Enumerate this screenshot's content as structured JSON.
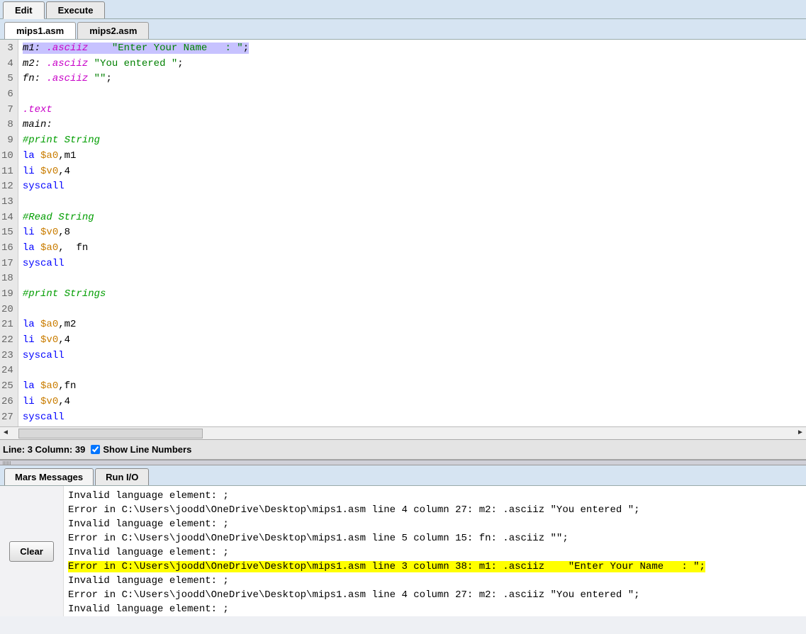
{
  "topTabs": {
    "edit": "Edit",
    "execute": "Execute",
    "active": "edit"
  },
  "fileTabs": {
    "files": [
      "mips1.asm",
      "mips2.asm"
    ],
    "active": 0
  },
  "editor": {
    "startLine": 3,
    "lines": [
      {
        "n": 3,
        "selected": true,
        "tokens": [
          [
            "lbl",
            "m1:"
          ],
          [
            "txt",
            " "
          ],
          [
            "dir",
            ".asciiz"
          ],
          [
            "txt",
            "    "
          ],
          [
            "str",
            "\"Enter Your Name   : \""
          ],
          [
            "punc",
            ";"
          ]
        ]
      },
      {
        "n": 4,
        "tokens": [
          [
            "lbl",
            "m2:"
          ],
          [
            "txt",
            " "
          ],
          [
            "dir",
            ".asciiz"
          ],
          [
            "txt",
            " "
          ],
          [
            "str",
            "\"You entered \""
          ],
          [
            "punc",
            ";"
          ]
        ]
      },
      {
        "n": 5,
        "tokens": [
          [
            "lbl",
            "fn:"
          ],
          [
            "txt",
            " "
          ],
          [
            "dir",
            ".asciiz"
          ],
          [
            "txt",
            " "
          ],
          [
            "str",
            "\"\""
          ],
          [
            "punc",
            ";"
          ]
        ]
      },
      {
        "n": 6,
        "tokens": []
      },
      {
        "n": 7,
        "tokens": [
          [
            "dir",
            ".text"
          ]
        ]
      },
      {
        "n": 8,
        "tokens": [
          [
            "lbl",
            "main:"
          ]
        ]
      },
      {
        "n": 9,
        "tokens": [
          [
            "cmt",
            "#print String"
          ]
        ]
      },
      {
        "n": 10,
        "tokens": [
          [
            "ins",
            "la"
          ],
          [
            "txt",
            " "
          ],
          [
            "reg",
            "$a0"
          ],
          [
            "punc",
            ","
          ],
          [
            "txt",
            "m1"
          ]
        ]
      },
      {
        "n": 11,
        "tokens": [
          [
            "ins",
            "li"
          ],
          [
            "txt",
            " "
          ],
          [
            "reg",
            "$v0"
          ],
          [
            "punc",
            ","
          ],
          [
            "num",
            "4"
          ]
        ]
      },
      {
        "n": 12,
        "tokens": [
          [
            "ins",
            "syscall"
          ]
        ]
      },
      {
        "n": 13,
        "tokens": []
      },
      {
        "n": 14,
        "tokens": [
          [
            "cmt",
            "#Read String"
          ]
        ]
      },
      {
        "n": 15,
        "tokens": [
          [
            "ins",
            "li"
          ],
          [
            "txt",
            " "
          ],
          [
            "reg",
            "$v0"
          ],
          [
            "punc",
            ","
          ],
          [
            "num",
            "8"
          ]
        ]
      },
      {
        "n": 16,
        "tokens": [
          [
            "ins",
            "la"
          ],
          [
            "txt",
            " "
          ],
          [
            "reg",
            "$a0"
          ],
          [
            "punc",
            ","
          ],
          [
            "txt",
            "  fn"
          ]
        ]
      },
      {
        "n": 17,
        "tokens": [
          [
            "ins",
            "syscall"
          ]
        ]
      },
      {
        "n": 18,
        "tokens": []
      },
      {
        "n": 19,
        "tokens": [
          [
            "cmt",
            "#print Strings"
          ]
        ]
      },
      {
        "n": 20,
        "tokens": []
      },
      {
        "n": 21,
        "tokens": [
          [
            "ins",
            "la"
          ],
          [
            "txt",
            " "
          ],
          [
            "reg",
            "$a0"
          ],
          [
            "punc",
            ","
          ],
          [
            "txt",
            "m2"
          ]
        ]
      },
      {
        "n": 22,
        "tokens": [
          [
            "ins",
            "li"
          ],
          [
            "txt",
            " "
          ],
          [
            "reg",
            "$v0"
          ],
          [
            "punc",
            ","
          ],
          [
            "num",
            "4"
          ]
        ]
      },
      {
        "n": 23,
        "tokens": [
          [
            "ins",
            "syscall"
          ]
        ]
      },
      {
        "n": 24,
        "tokens": []
      },
      {
        "n": 25,
        "tokens": [
          [
            "ins",
            "la"
          ],
          [
            "txt",
            " "
          ],
          [
            "reg",
            "$a0"
          ],
          [
            "punc",
            ","
          ],
          [
            "txt",
            "fn"
          ]
        ]
      },
      {
        "n": 26,
        "tokens": [
          [
            "ins",
            "li"
          ],
          [
            "txt",
            " "
          ],
          [
            "reg",
            "$v0"
          ],
          [
            "punc",
            ","
          ],
          [
            "num",
            "4"
          ]
        ]
      },
      {
        "n": 27,
        "tokens": [
          [
            "ins",
            "syscall"
          ]
        ]
      }
    ]
  },
  "status": {
    "lineLabel": "Line:",
    "lineValue": "3",
    "colLabel": "Column:",
    "colValue": "39",
    "showLineNumbers": "Show Line Numbers",
    "showLineNumbersChecked": true
  },
  "msgTabs": {
    "mars": "Mars Messages",
    "runio": "Run I/O",
    "active": "mars"
  },
  "clearLabel": "Clear",
  "messages": [
    {
      "text": "Invalid language element: ;"
    },
    {
      "text": "Error in C:\\Users\\joodd\\OneDrive\\Desktop\\mips1.asm line 4 column 27: m2: .asciiz \"You entered \";"
    },
    {
      "text": "Invalid language element: ;"
    },
    {
      "text": "Error in C:\\Users\\joodd\\OneDrive\\Desktop\\mips1.asm line 5 column 15: fn: .asciiz \"\";"
    },
    {
      "text": "Invalid language element: ;"
    },
    {
      "text": "Error in C:\\Users\\joodd\\OneDrive\\Desktop\\mips1.asm line 3 column 38: m1: .asciiz    \"Enter Your Name   : \";",
      "hl": true
    },
    {
      "text": "Invalid language element: ;"
    },
    {
      "text": "Error in C:\\Users\\joodd\\OneDrive\\Desktop\\mips1.asm line 4 column 27: m2: .asciiz \"You entered \";"
    },
    {
      "text": "Invalid language element: ;"
    }
  ]
}
